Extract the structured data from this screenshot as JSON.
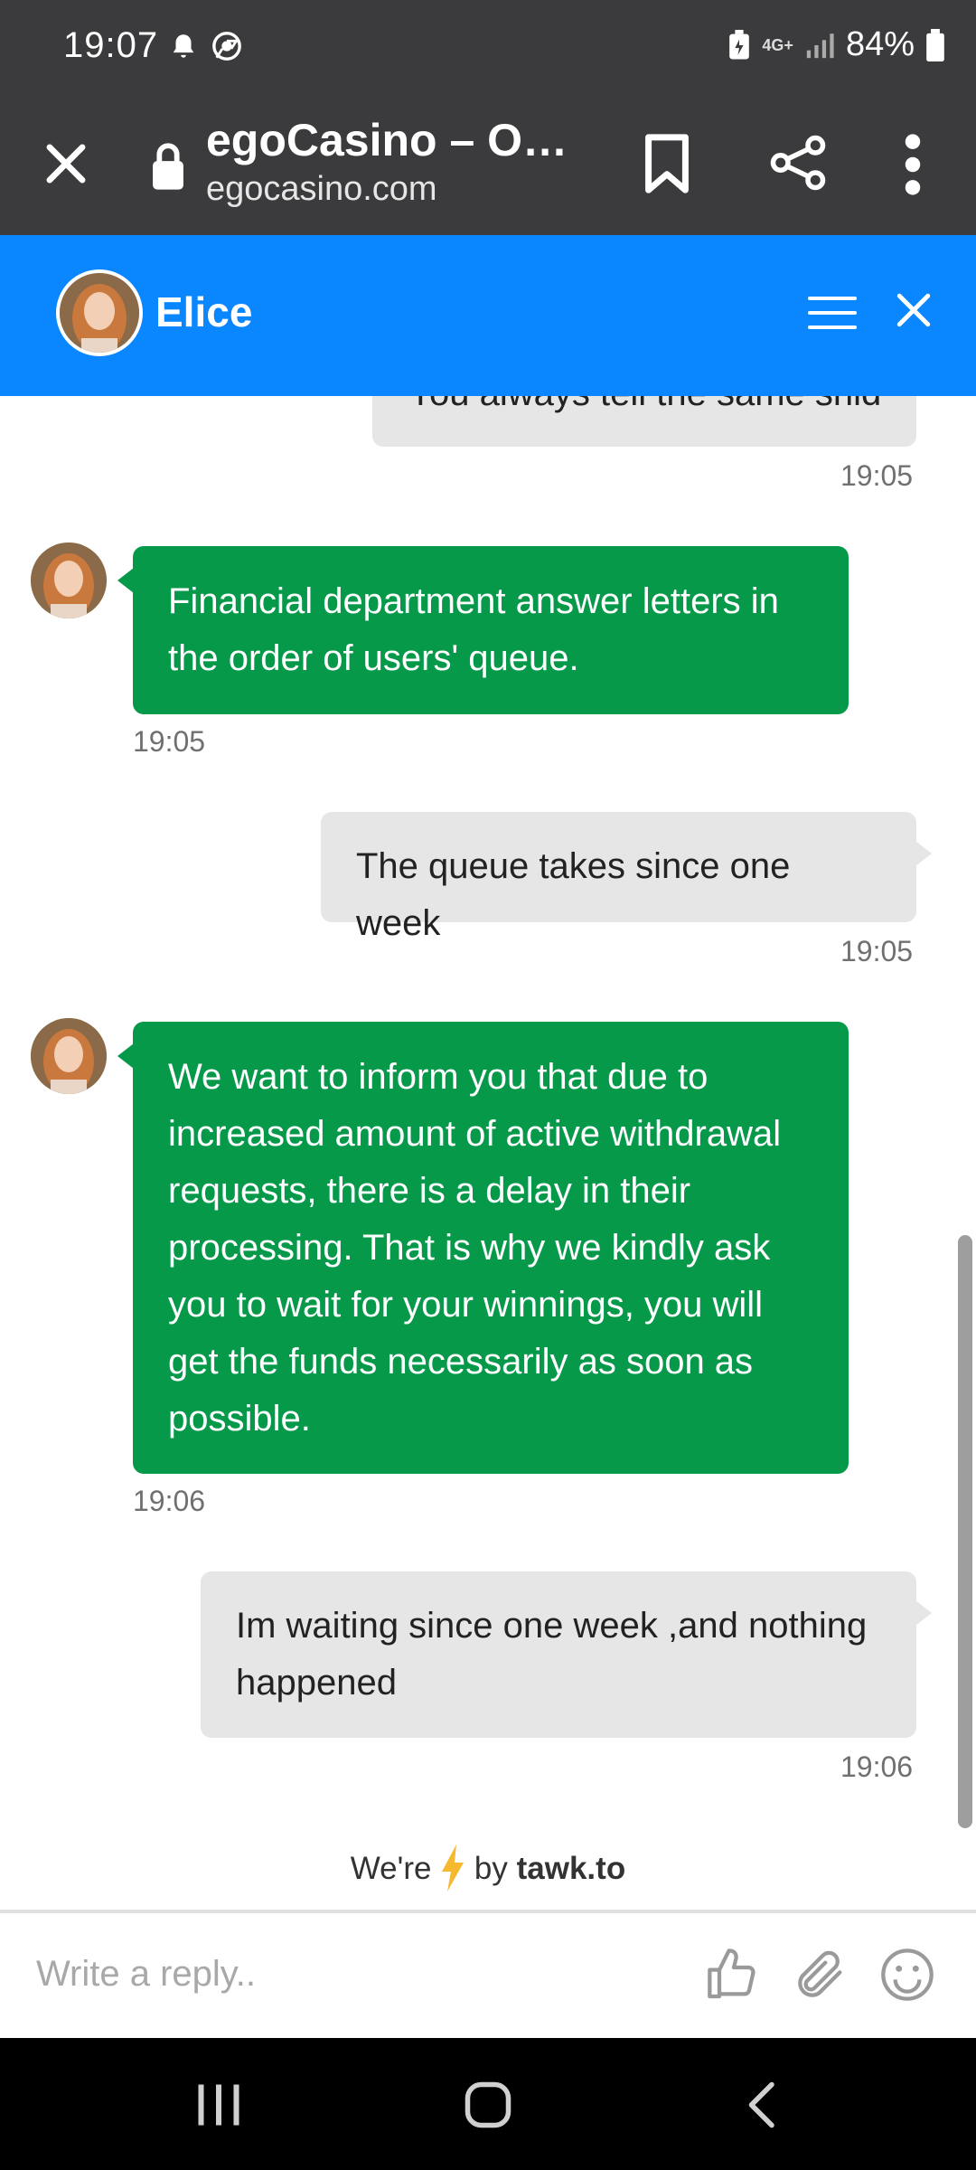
{
  "status_bar": {
    "time": "19:07",
    "network": "4G+",
    "battery": "84%",
    "icons": [
      "alarm-icon",
      "chrome-icon",
      "battery-saver-icon",
      "signal-icon",
      "battery-icon"
    ]
  },
  "browser": {
    "title": "egoCasino – On…",
    "url": "egocasino.com",
    "icons": [
      "close-icon",
      "lock-icon",
      "bookmark-icon",
      "share-icon",
      "more-icon"
    ]
  },
  "chat": {
    "agent_name": "Elice",
    "header_color": "#0a86ff",
    "agent_bubble_color": "#07994a",
    "visitor_bubble_color": "#e6e6e6",
    "messages": [
      {
        "from": "visitor",
        "lines": [
          "You always tell the same shid"
        ],
        "time": "19:05"
      },
      {
        "from": "agent",
        "lines": [
          "Financial department answer letters  in",
          "the order of users' queue."
        ],
        "time": "19:05"
      },
      {
        "from": "visitor",
        "lines": [
          "The queue takes since one week"
        ],
        "time": "19:05"
      },
      {
        "from": "agent",
        "lines": [
          "We want to inform you that due to",
          "increased amount of active withdrawal",
          "requests, there is a delay in their",
          "processing. That is why we kindly ask",
          "you to wait for your winnings, you will",
          "get the funds necessarily as soon as",
          "possible."
        ],
        "time": "19:06"
      },
      {
        "from": "visitor",
        "lines": [
          "Im waiting since one week ,and nothing",
          "happened"
        ],
        "time": "19:06"
      }
    ]
  },
  "powered_by": {
    "prefix": "We're",
    "middle": "by",
    "brand": "tawk.to",
    "bolt_color": "#f5b82e"
  },
  "composer": {
    "placeholder": "Write a reply..",
    "icons": [
      "thumbs-up-icon",
      "paperclip-icon",
      "emoji-icon"
    ]
  },
  "nav_bar": {
    "icons": [
      "recent-apps-icon",
      "home-icon",
      "back-icon"
    ]
  }
}
